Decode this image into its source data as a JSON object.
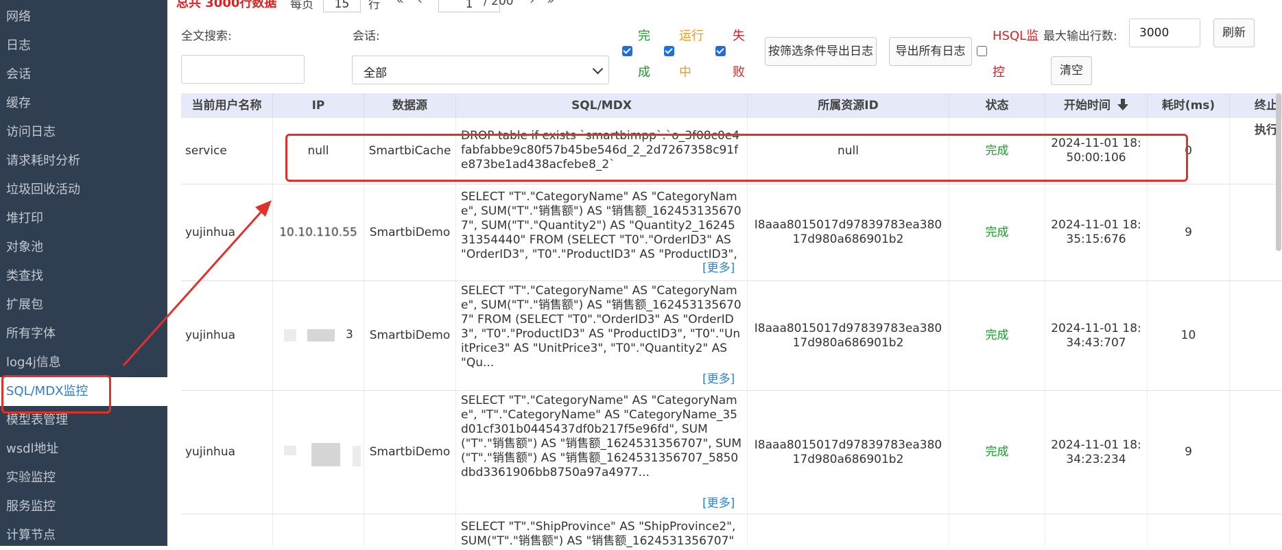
{
  "sidebar": {
    "items": [
      {
        "label": "网络"
      },
      {
        "label": "日志"
      },
      {
        "label": "会话"
      },
      {
        "label": "缓存"
      },
      {
        "label": "访问日志"
      },
      {
        "label": "请求耗时分析"
      },
      {
        "label": "垃圾回收活动"
      },
      {
        "label": "堆打印"
      },
      {
        "label": "对象池"
      },
      {
        "label": "类查找"
      },
      {
        "label": "扩展包"
      },
      {
        "label": "所有字体"
      },
      {
        "label": "log4j信息"
      },
      {
        "label": "SQL/MDX监控",
        "active": true
      },
      {
        "label": "模型表管理"
      },
      {
        "label": "wsdl地址"
      },
      {
        "label": "实验监控"
      },
      {
        "label": "服务监控"
      },
      {
        "label": "计算节点"
      }
    ]
  },
  "pager": {
    "total": "总共  3000行数据",
    "per_page_label": "每页",
    "per_page_value": "15",
    "row_unit": "行",
    "first_icon": "double-chevron-left",
    "prev_icon": "chevron-left",
    "page_value": "1",
    "page_total": "/ 200",
    "next_icon": "chevron-right",
    "last_icon": "double-chevron-right"
  },
  "filters": {
    "fulltext_label": "全文搜索:",
    "fulltext_value": "",
    "session_label": "会话:",
    "session_value": "全部",
    "status": [
      {
        "top": "完",
        "bottom": "成",
        "checked": true,
        "color": "#1a9b2a"
      },
      {
        "top": "运行",
        "bottom": "中",
        "checked": true,
        "color": "#f39a1a"
      },
      {
        "top": "失",
        "bottom": "败",
        "checked": true,
        "color": "#e02020"
      }
    ],
    "export_filtered_label": "按筛选条件导出日志",
    "export_all_label": "导出所有日志",
    "hsql_top": "HSQL监",
    "hsql_bottom": "控",
    "hsql_checked": false,
    "max_rows_label": "最大输出行数:",
    "max_rows_value": "3000",
    "refresh_label": "刷新",
    "clear_label": "清空"
  },
  "table": {
    "headers": [
      "当前用户名称",
      "IP",
      "数据源",
      "SQL/MDX",
      "所属资源ID",
      "状态",
      "开始时间",
      "耗时(ms)",
      "终止执行"
    ],
    "sort_icon": "arrow-down-icon",
    "more_label": "[更多]",
    "rows": [
      {
        "user": "service",
        "ip": "null",
        "source": "SmartbiCache",
        "sql": "DROP table if exists `smartbimpp`.`o_3f08c0e4fabfabbe9c80f57b45be546d_2_2d7267358c91fe873be1ad438acfebe8_2`",
        "resource": "null",
        "status": "完成",
        "start": "2024-11-01 18:50:00:106",
        "elapsed": "0"
      },
      {
        "user": "yujinhua",
        "ip": "10.10.110.55",
        "source": "SmartbiDemo",
        "sql": "SELECT \"T\".\"CategoryName\" AS \"CategoryName\", SUM(\"T\".\"销售额\") AS \"销售额_1624531356707\", SUM(\"T\".\"Quantity2\") AS \"Quantity2_1624531354440\" FROM (SELECT \"T0\".\"OrderID3\" AS \"OrderID3\", \"T0\".\"ProductID3\" AS \"ProductID3\", \"T0\"...",
        "resource": "I8aaa8015017d97839783ea38017d980a686901b2",
        "status": "完成",
        "start": "2024-11-01 18:35:15:676",
        "elapsed": "9"
      },
      {
        "user": "yujinhua",
        "ip": "3",
        "source": "SmartbiDemo",
        "sql": "SELECT \"T\".\"CategoryName\" AS \"CategoryName\", SUM(\"T\".\"销售额\") AS \"销售额_1624531356707\" FROM (SELECT \"T0\".\"OrderID3\" AS \"OrderID3\", \"T0\".\"ProductID3\" AS \"ProductID3\", \"T0\".\"UnitPrice3\" AS \"UnitPrice3\", \"T0\".\"Quantity2\" AS \"Qu...",
        "resource": "I8aaa8015017d97839783ea38017d980a686901b2",
        "status": "完成",
        "start": "2024-11-01 18:34:43:707",
        "elapsed": "10"
      },
      {
        "user": "yujinhua",
        "ip": "",
        "source": "SmartbiDemo",
        "sql": "SELECT \"T\".\"CategoryName\" AS \"CategoryName\", \"T\".\"CategoryName\" AS \"CategoryName_35d01cf301b0445437df0b217f5e96fd\", SUM(\"T\".\"销售额\") AS \"销售额_1624531356707\", SUM(\"T\".\"销售额\") AS \"销售额_1624531356707_5850dbd3361906bb8750a97a4977...",
        "resource": "I8aaa8015017d97839783ea38017d980a686901b2",
        "status": "完成",
        "start": "2024-11-01 18:34:23:234",
        "elapsed": "9"
      },
      {
        "user": "",
        "ip": "",
        "source": "",
        "sql": "SELECT \"T\".\"ShipProvince\" AS \"ShipProvince2\", SUM(\"T\".\"销售额\") AS \"销售额_1624531356707\"",
        "resource": "",
        "status": "",
        "start": "",
        "elapsed": ""
      }
    ]
  },
  "annotation_color": "#e0312b"
}
